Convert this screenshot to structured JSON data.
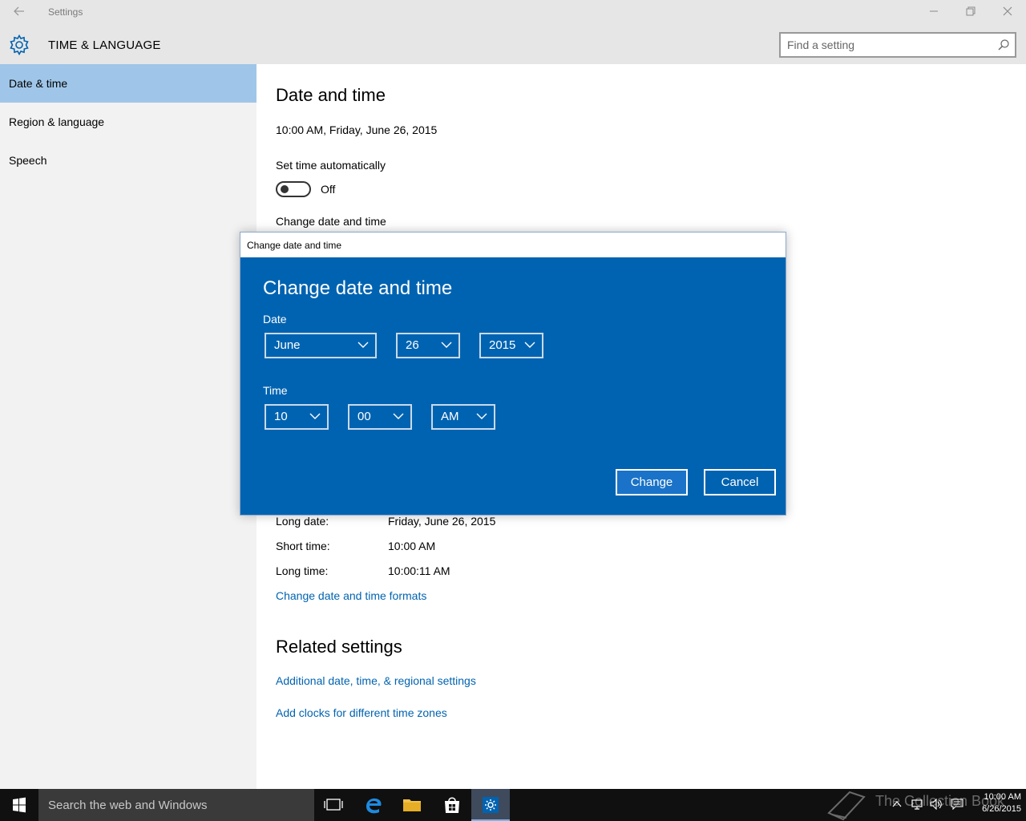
{
  "window": {
    "app_title": "Settings",
    "back_icon": "back-arrow-icon",
    "controls": {
      "minimize": "–",
      "maximize": "❐",
      "close": "✕"
    }
  },
  "header": {
    "section_title": "TIME & LANGUAGE",
    "search_placeholder": "Find a setting"
  },
  "sidebar": {
    "items": [
      {
        "label": "Date & time",
        "active": true
      },
      {
        "label": "Region & language",
        "active": false
      },
      {
        "label": "Speech",
        "active": false
      }
    ]
  },
  "main": {
    "title": "Date and time",
    "current_datetime": "10:00 AM, Friday, June 26, 2015",
    "set_time_auto_label": "Set time automatically",
    "set_time_auto_state": "Off",
    "change_label": "Change date and time",
    "formats": [
      {
        "label": "Long date:",
        "value": "Friday, June 26, 2015"
      },
      {
        "label": "Short time:",
        "value": "10:00 AM"
      },
      {
        "label": "Long time:",
        "value": "10:00:11 AM"
      }
    ],
    "formats_link": "Change date and time formats",
    "related_title": "Related settings",
    "related_links": [
      "Additional date, time, & regional settings",
      "Add clocks for different time zones"
    ]
  },
  "dialog": {
    "window_title": "Change date and time",
    "heading": "Change date and time",
    "date_label": "Date",
    "month": "June",
    "day": "26",
    "year": "2015",
    "time_label": "Time",
    "hour": "10",
    "minute": "00",
    "ampm": "AM",
    "change_button": "Change",
    "cancel_button": "Cancel"
  },
  "taskbar": {
    "search_text": "Search the web and Windows",
    "watermark": "The Collection Book",
    "clock_time": "10:00 AM",
    "clock_date": "6/26/2015",
    "pinned": [
      "task-view-icon",
      "edge-icon",
      "file-explorer-icon",
      "store-icon",
      "settings-icon"
    ]
  },
  "colors": {
    "accent": "#0063b1",
    "sidebar_active": "#9fc6e8",
    "link": "#0063b1"
  }
}
